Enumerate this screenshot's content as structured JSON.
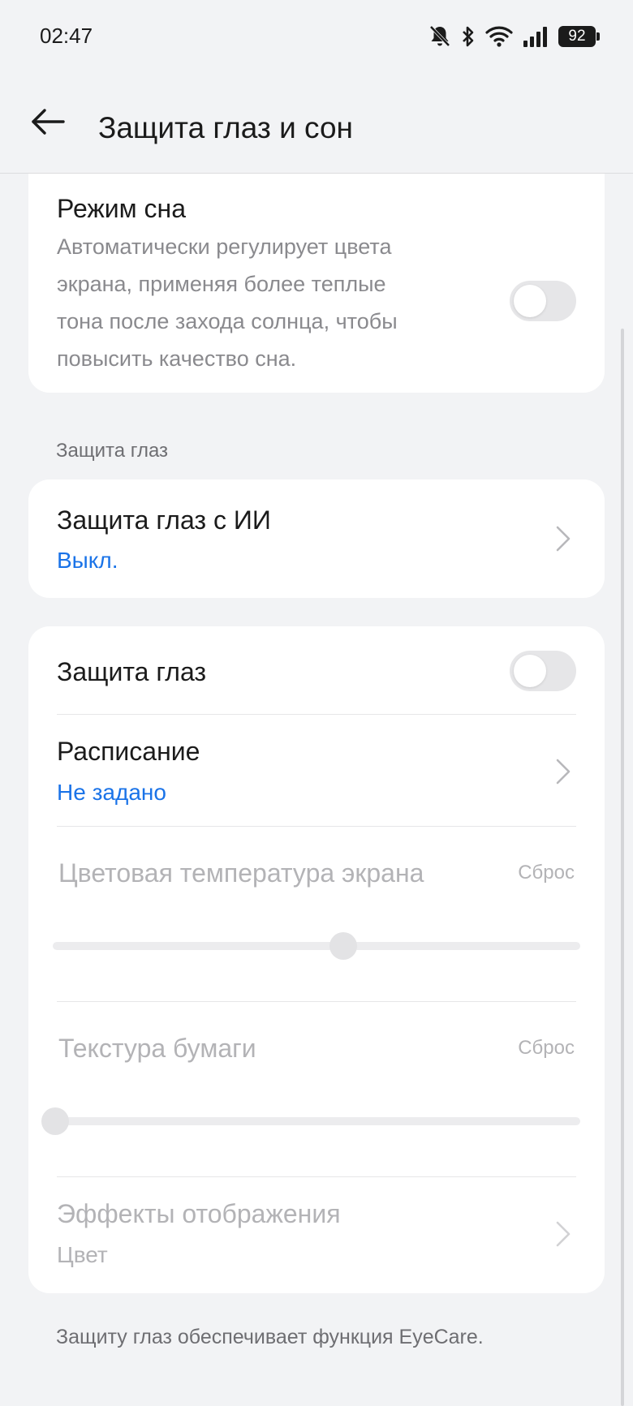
{
  "status_bar": {
    "time": "02:47",
    "battery": "92",
    "icons": [
      "bell-off-icon",
      "bluetooth-icon",
      "wifi-icon",
      "signal-icon",
      "battery-icon"
    ]
  },
  "header": {
    "title": "Защита глаз и сон",
    "back_icon": "arrow-left-icon"
  },
  "sleep_mode": {
    "title": "Режим сна",
    "description": "Автоматически регулирует цвета экрана, применяя более теплые тона после захода солнца, чтобы повысить качество сна.",
    "enabled": false
  },
  "eye_protection_section": {
    "header": "Защита глаз",
    "ai_eye_protection": {
      "title": "Защита глаз с ИИ",
      "value": "Выкл."
    },
    "eye_protection": {
      "title": "Защита глаз",
      "enabled": false
    },
    "schedule": {
      "title": "Расписание",
      "value": "Не задано"
    },
    "color_temperature": {
      "title": "Цветовая температура экрана",
      "reset_label": "Сброс",
      "level": 0.55
    },
    "paper_texture": {
      "title": "Текстура бумаги",
      "reset_label": "Сброс",
      "level": 0
    },
    "display_effects": {
      "title": "Эффекты отображения",
      "value": "Цвет"
    }
  },
  "footer_note": "Защиту глаз обеспечивает функция EyeCare.",
  "colors": {
    "background": "#f2f3f5",
    "card": "#ffffff",
    "accent": "#1a73e8",
    "disabled_text": "#b3b3b6"
  }
}
